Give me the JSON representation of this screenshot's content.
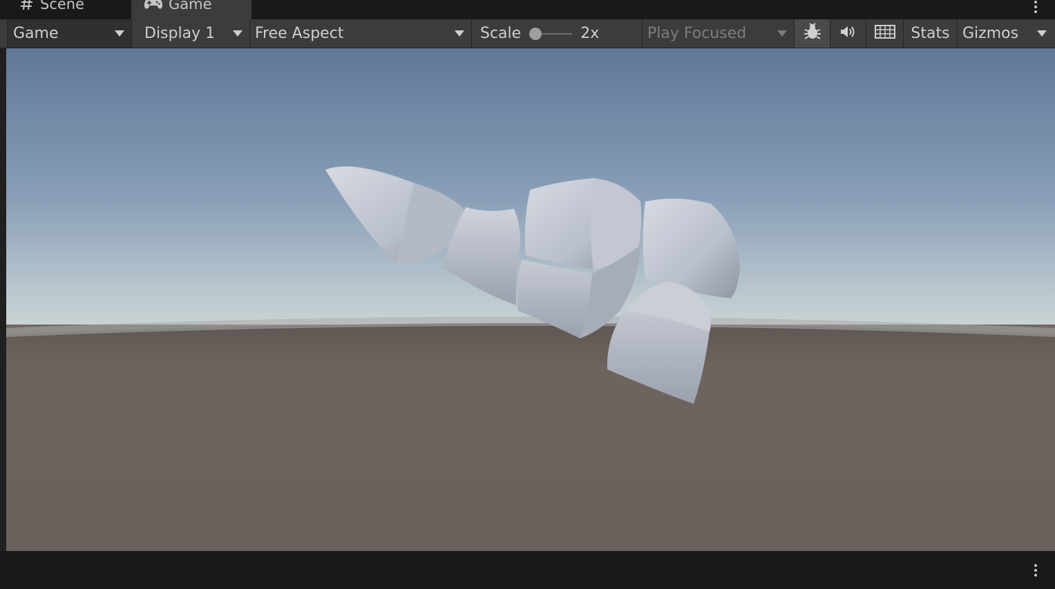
{
  "tabs": {
    "scene": {
      "label": "Scene",
      "icon": "hash-icon"
    },
    "game": {
      "label": "Game",
      "icon": "gamepad-icon",
      "active": true
    }
  },
  "toolbar": {
    "game_view_dropdown": "Game",
    "display_dropdown": "Display 1",
    "aspect_dropdown": "Free Aspect",
    "scale_label": "Scale",
    "scale_value": "2x",
    "play_mode_dropdown": "Play Focused",
    "stats_label": "Stats",
    "gizmos_label": "Gizmos",
    "icons": {
      "bug": "bug-icon",
      "audio": "speaker-icon",
      "grid": "keyboard-grid-icon"
    }
  },
  "viewport": {
    "scene_description_none": "",
    "colors": {
      "sky_top": "#5f7896",
      "sky_horizon": "#c9d3d3",
      "ground": "#6a605b",
      "object": "#c5cad5"
    }
  },
  "theme": {
    "panel": "#3c3c3c",
    "background": "#191919",
    "text": "#cfcfcf",
    "disabled_text": "#7d7d7d"
  }
}
